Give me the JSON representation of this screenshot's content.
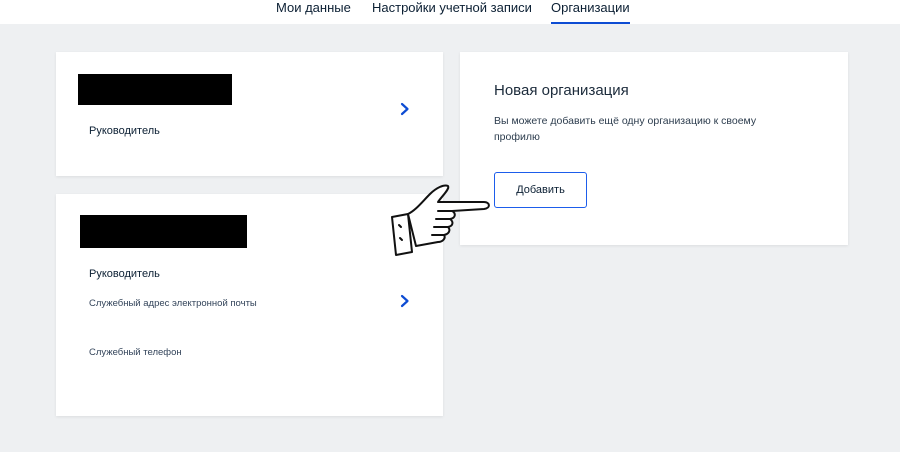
{
  "tabs": [
    {
      "label": "Мои данные"
    },
    {
      "label": "Настройки учетной записи"
    },
    {
      "label": "Организации"
    }
  ],
  "org_cards": [
    {
      "role": "Руководитель"
    },
    {
      "role": "Руководитель",
      "email_label": "Служебный адрес электронной почты",
      "phone_label": "Служебный телефон"
    }
  ],
  "new_org": {
    "title": "Новая организация",
    "description": "Вы можете добавить ещё одну организацию к своему профилю",
    "button": "Добавить"
  },
  "colors": {
    "accent": "#0d4cd3",
    "text": "#0b1f33",
    "background": "#eef0f2"
  },
  "icons": [
    "chevron-right-icon",
    "pointing-hand-icon"
  ]
}
